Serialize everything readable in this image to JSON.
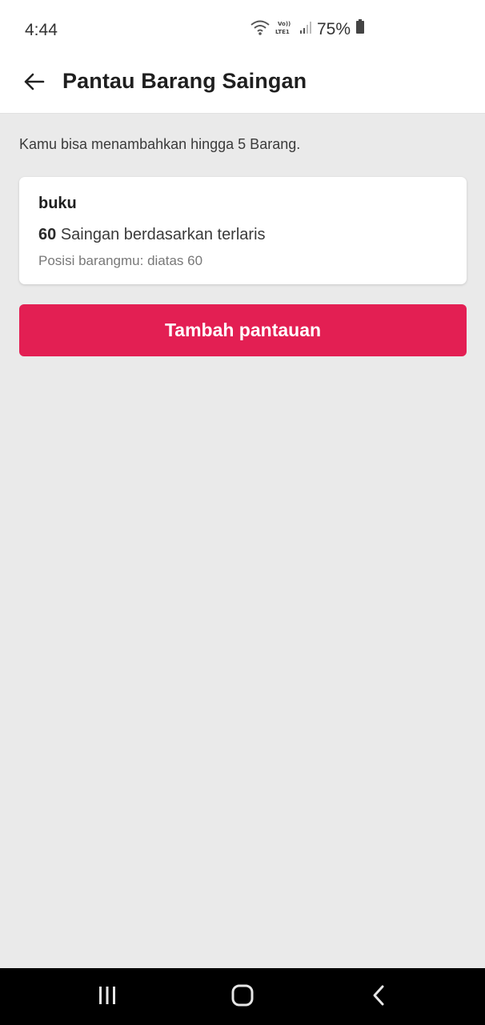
{
  "status_bar": {
    "time": "4:44",
    "battery": "75%",
    "icons": [
      "wifi-icon",
      "volte-lte-icon",
      "signal-icon",
      "battery-icon"
    ]
  },
  "header": {
    "title": "Pantau Barang Saingan",
    "back_icon": "arrow-left-icon"
  },
  "info": {
    "text": "Kamu bisa menambahkan hingga 5 Barang."
  },
  "card": {
    "title": "buku",
    "count": "60",
    "count_label": "Saingan berdasarkan terlaris",
    "position_text": "Posisi barangmu: diatas 60"
  },
  "add_button": {
    "label": "Tambah pantauan",
    "color": "#e31f53"
  },
  "nav_bar": {
    "icons": [
      "recent-apps-icon",
      "home-icon",
      "back-icon"
    ]
  }
}
